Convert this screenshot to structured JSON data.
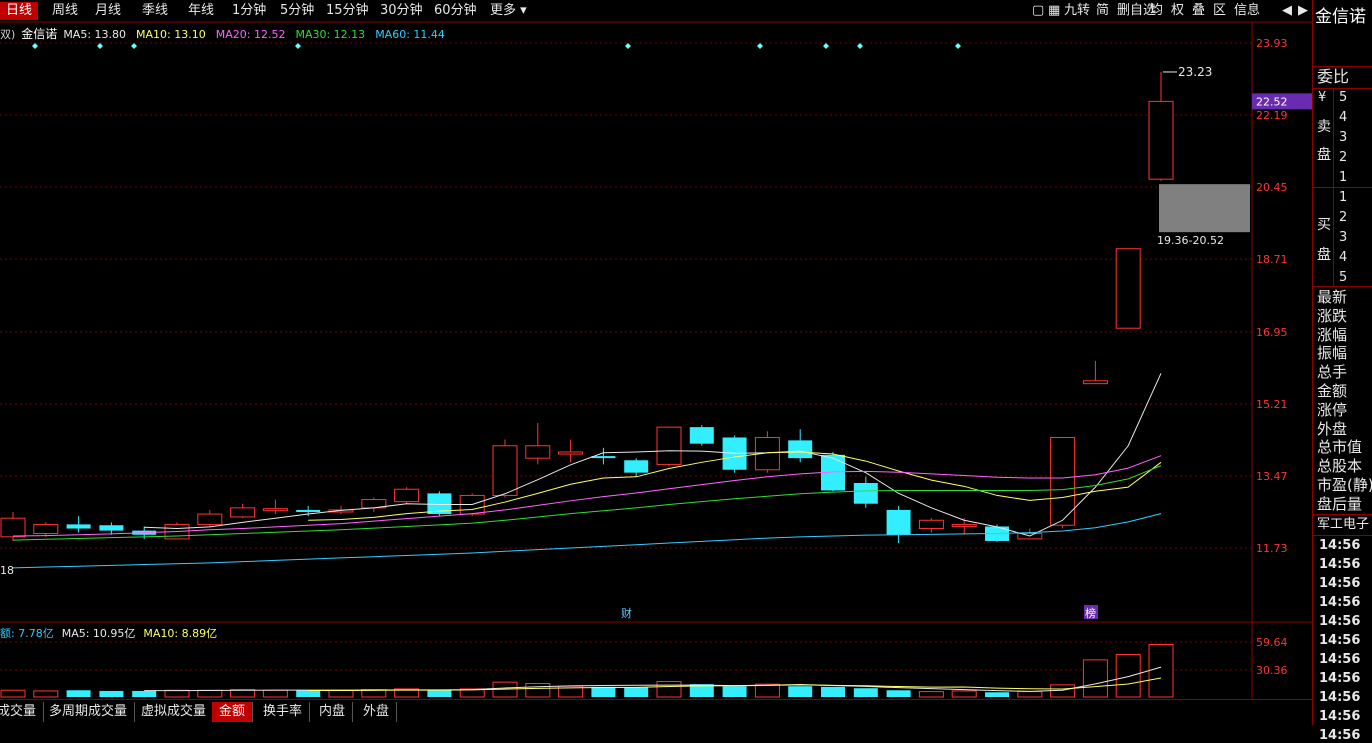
{
  "toolbar": {
    "periods": [
      "日线",
      "周线",
      "月线",
      "季线",
      "年线",
      "1分钟",
      "5分钟",
      "15分钟",
      "30分钟",
      "60分钟",
      "更多"
    ],
    "active_period": 0,
    "right_tools": [
      "九转",
      "简",
      "删自选",
      "均",
      "权",
      "叠",
      "区",
      "信息"
    ]
  },
  "legend": {
    "prefix": "双)",
    "stock": "金信诺",
    "items": [
      {
        "label": "MA5: 13.80",
        "color": "#e8e8e8"
      },
      {
        "label": "MA10: 13.10",
        "color": "#ffff66"
      },
      {
        "label": "MA20: 12.52",
        "color": "#ff66ff"
      },
      {
        "label": "MA30: 12.13",
        "color": "#33dd33"
      },
      {
        "label": "MA60: 11.44",
        "color": "#33ccff"
      }
    ]
  },
  "vol_legend": {
    "items": [
      {
        "label": "额: 7.78亿",
        "color": "#33ccff"
      },
      {
        "label": "MA5: 10.95亿",
        "color": "#e8e8e8"
      },
      {
        "label": "MA10: 8.89亿",
        "color": "#ffff66"
      }
    ]
  },
  "price_axis": [
    "23.93",
    "22.19",
    "20.45",
    "18.71",
    "16.95",
    "15.21",
    "13.47",
    "11.73"
  ],
  "vol_axis": [
    "59.64",
    "30.36"
  ],
  "current_price_tag": "22.52",
  "high_marker": "23.23",
  "low_marker": "18",
  "range_label": "19.36-20.52",
  "event_markers": [
    "财",
    "榜"
  ],
  "right_panel": {
    "title": "金信诺",
    "weibi": "委比",
    "yen": "¥",
    "sell_label": [
      "卖",
      "盘"
    ],
    "buy_label": [
      "买",
      "盘"
    ],
    "sell_levels": [
      "5",
      "4",
      "3",
      "2",
      "1"
    ],
    "buy_levels": [
      "1",
      "2",
      "3",
      "4",
      "5"
    ],
    "fields": [
      "最新",
      "涨跌",
      "涨幅",
      "振幅",
      "总手",
      "金额",
      "涨停",
      "外盘",
      "总市值",
      "总股本",
      "市盈(静)",
      "盘后量"
    ],
    "sector": "军工电子",
    "ticks": [
      "14:56",
      "14:56",
      "14:56",
      "14:56",
      "14:56",
      "14:56",
      "14:56",
      "14:56",
      "14:56",
      "14:56",
      "14:56"
    ]
  },
  "bottom_tabs": [
    "成交量",
    "多周期成交量",
    "虚拟成交量",
    "金额",
    "换手率",
    "内盘",
    "外盘"
  ],
  "active_tab": 3,
  "chart_data": {
    "type": "candlestick",
    "candles": [
      {
        "o": 12.0,
        "c": 12.45,
        "h": 12.6,
        "l": 11.9
      },
      {
        "o": 12.08,
        "c": 12.3,
        "h": 12.35,
        "l": 12.0
      },
      {
        "o": 12.3,
        "c": 12.2,
        "h": 12.5,
        "l": 12.1
      },
      {
        "o": 12.28,
        "c": 12.15,
        "h": 12.35,
        "l": 12.05
      },
      {
        "o": 12.15,
        "c": 12.05,
        "h": 12.25,
        "l": 11.95
      },
      {
        "o": 11.95,
        "c": 12.3,
        "h": 12.35,
        "l": 11.95
      },
      {
        "o": 12.3,
        "c": 12.55,
        "h": 12.65,
        "l": 12.25
      },
      {
        "o": 12.48,
        "c": 12.7,
        "h": 12.8,
        "l": 12.45
      },
      {
        "o": 12.65,
        "c": 12.68,
        "h": 12.9,
        "l": 12.55
      },
      {
        "o": 12.65,
        "c": 12.6,
        "h": 12.75,
        "l": 12.5
      },
      {
        "o": 12.6,
        "c": 12.65,
        "h": 12.75,
        "l": 12.55
      },
      {
        "o": 12.7,
        "c": 12.9,
        "h": 12.95,
        "l": 12.6
      },
      {
        "o": 12.85,
        "c": 13.15,
        "h": 13.2,
        "l": 12.8
      },
      {
        "o": 13.05,
        "c": 12.55,
        "h": 13.1,
        "l": 12.5
      },
      {
        "o": 12.55,
        "c": 13.0,
        "h": 13.05,
        "l": 12.5
      },
      {
        "o": 13.0,
        "c": 14.2,
        "h": 14.35,
        "l": 12.95
      },
      {
        "o": 13.9,
        "c": 14.2,
        "h": 14.75,
        "l": 13.75
      },
      {
        "o": 14.0,
        "c": 14.05,
        "h": 14.35,
        "l": 13.8
      },
      {
        "o": 13.95,
        "c": 13.92,
        "h": 14.15,
        "l": 13.75
      },
      {
        "o": 13.85,
        "c": 13.55,
        "h": 13.9,
        "l": 13.45
      },
      {
        "o": 13.75,
        "c": 14.65,
        "h": 14.65,
        "l": 13.7
      },
      {
        "o": 14.65,
        "c": 14.25,
        "h": 14.7,
        "l": 14.2
      },
      {
        "o": 14.4,
        "c": 13.62,
        "h": 14.45,
        "l": 13.55
      },
      {
        "o": 13.62,
        "c": 14.4,
        "h": 14.55,
        "l": 13.55
      },
      {
        "o": 14.33,
        "c": 13.9,
        "h": 14.6,
        "l": 13.8
      },
      {
        "o": 13.98,
        "c": 13.12,
        "h": 14.05,
        "l": 13.1
      },
      {
        "o": 13.3,
        "c": 12.8,
        "h": 13.45,
        "l": 12.7
      },
      {
        "o": 12.65,
        "c": 12.05,
        "h": 12.75,
        "l": 11.85
      },
      {
        "o": 12.2,
        "c": 12.4,
        "h": 12.45,
        "l": 12.1
      },
      {
        "o": 12.3,
        "c": 12.3,
        "h": 12.45,
        "l": 12.05
      },
      {
        "o": 12.25,
        "c": 11.9,
        "h": 12.3,
        "l": 11.88
      },
      {
        "o": 11.95,
        "c": 12.08,
        "h": 12.2,
        "l": 11.95
      },
      {
        "o": 12.28,
        "c": 14.4,
        "h": 14.4,
        "l": 12.2
      },
      {
        "o": 15.7,
        "c": 15.77,
        "h": 16.25,
        "l": 15.7
      },
      {
        "o": 17.04,
        "c": 18.96,
        "h": 18.96,
        "l": 17.04
      },
      {
        "o": 20.64,
        "c": 22.52,
        "h": 23.23,
        "l": 20.6
      }
    ],
    "ma": [
      {
        "name": "MA5",
        "color": "#e8e8e8",
        "values": [
          null,
          null,
          null,
          null,
          12.23,
          12.2,
          12.24,
          12.35,
          12.45,
          12.55,
          12.64,
          12.7,
          12.8,
          12.78,
          12.78,
          13.04,
          13.38,
          13.74,
          14.03,
          14.05,
          14.08,
          14.07,
          14.02,
          14.03,
          14.07,
          13.9,
          13.55,
          13.05,
          12.7,
          12.4,
          12.24,
          12.02,
          12.4,
          13.2,
          14.2,
          15.95
        ]
      },
      {
        "name": "MA10",
        "color": "#ffff66",
        "values": [
          null,
          null,
          null,
          null,
          null,
          null,
          null,
          null,
          null,
          12.4,
          12.42,
          12.47,
          12.56,
          12.62,
          12.66,
          12.84,
          13.05,
          13.27,
          13.42,
          13.45,
          13.65,
          13.8,
          13.93,
          14.03,
          14.05,
          14.0,
          13.83,
          13.59,
          13.37,
          13.22,
          13.0,
          12.88,
          12.95,
          13.1,
          13.2,
          13.8
        ]
      },
      {
        "name": "MA20",
        "color": "#ff66ff",
        "values": [
          12.02,
          12.03,
          12.05,
          12.07,
          12.1,
          12.13,
          12.17,
          12.2,
          12.24,
          12.28,
          12.32,
          12.38,
          12.44,
          12.5,
          12.56,
          12.65,
          12.76,
          12.87,
          12.97,
          13.06,
          13.16,
          13.26,
          13.36,
          13.45,
          13.52,
          13.57,
          13.58,
          13.56,
          13.52,
          13.48,
          13.44,
          13.42,
          13.42,
          13.5,
          13.66,
          13.96
        ]
      },
      {
        "name": "MA30",
        "color": "#33dd33",
        "values": [
          11.92,
          11.94,
          11.96,
          11.98,
          12.0,
          12.02,
          12.05,
          12.08,
          12.11,
          12.14,
          12.17,
          12.21,
          12.25,
          12.29,
          12.33,
          12.4,
          12.48,
          12.56,
          12.63,
          12.7,
          12.78,
          12.85,
          12.92,
          12.98,
          13.04,
          13.08,
          13.11,
          13.12,
          13.12,
          13.12,
          13.12,
          13.12,
          13.14,
          13.24,
          13.4,
          13.72
        ]
      },
      {
        "name": "MA60",
        "color": "#33ccff",
        "values": [
          11.25,
          11.27,
          11.29,
          11.31,
          11.33,
          11.35,
          11.37,
          11.4,
          11.43,
          11.46,
          11.49,
          11.52,
          11.55,
          11.58,
          11.61,
          11.65,
          11.69,
          11.73,
          11.77,
          11.81,
          11.85,
          11.89,
          11.93,
          11.97,
          12.0,
          12.02,
          12.04,
          12.05,
          12.06,
          12.07,
          12.08,
          12.1,
          12.14,
          12.22,
          12.36,
          12.56
        ]
      }
    ],
    "volume": [
      1.0,
      0.9,
      1.0,
      0.9,
      0.9,
      1.0,
      1.0,
      1.1,
      1.0,
      1.0,
      1.0,
      1.1,
      1.2,
      1.0,
      1.2,
      2.2,
      2.0,
      1.6,
      1.5,
      1.4,
      2.3,
      1.9,
      1.6,
      1.9,
      1.6,
      1.5,
      1.3,
      1.0,
      0.8,
      0.9,
      0.7,
      0.8,
      1.8,
      5.5,
      6.3,
      7.78
    ],
    "vol_ma5": [
      null,
      null,
      null,
      null,
      0.94,
      0.94,
      0.96,
      1.0,
      1.02,
      1.02,
      1.02,
      1.04,
      1.06,
      1.06,
      1.1,
      1.34,
      1.52,
      1.64,
      1.7,
      1.74,
      1.76,
      1.76,
      1.68,
      1.74,
      1.86,
      1.7,
      1.58,
      1.38,
      1.24,
      1.1,
      0.94,
      0.84,
      1.0,
      1.94,
      3.02,
      4.42
    ],
    "vol_ma10": [
      null,
      null,
      null,
      null,
      null,
      null,
      null,
      null,
      null,
      0.97,
      0.97,
      0.99,
      1.01,
      1.02,
      1.05,
      1.17,
      1.28,
      1.35,
      1.4,
      1.42,
      1.55,
      1.64,
      1.66,
      1.72,
      1.8,
      1.73,
      1.66,
      1.55,
      1.47,
      1.48,
      1.32,
      1.22,
      1.19,
      1.53,
      1.92,
      2.82
    ],
    "price_range": [
      10.0,
      24.3
    ],
    "vol_range": [
      0,
      8.4
    ]
  }
}
